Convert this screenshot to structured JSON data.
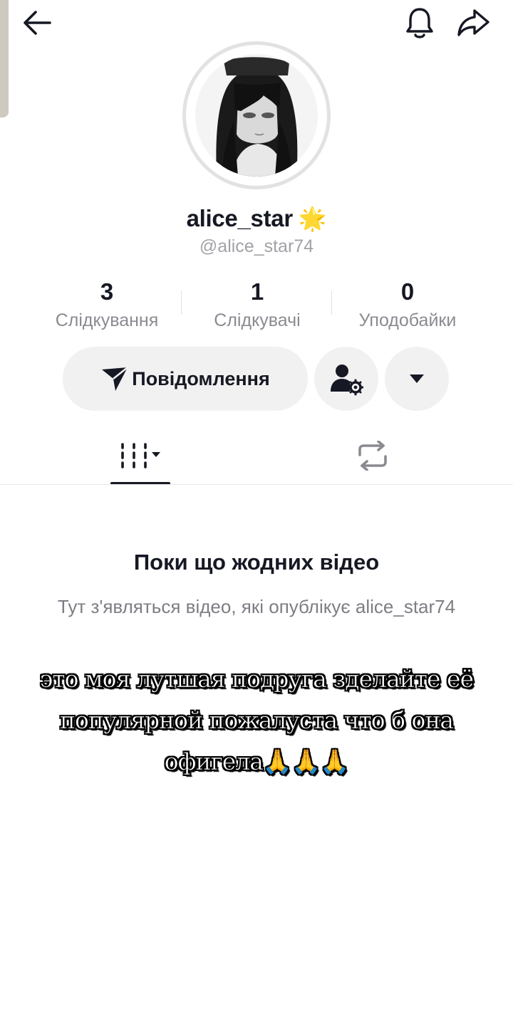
{
  "profile": {
    "display_name": "alice_star",
    "name_badge": "🌟",
    "username": "@alice_star74"
  },
  "stats": [
    {
      "value": "3",
      "label": "Слідкування"
    },
    {
      "value": "1",
      "label": "Слідкувачі"
    },
    {
      "value": "0",
      "label": "Уподобайки"
    }
  ],
  "actions": {
    "message_label": "Повідомлення"
  },
  "tabs": {
    "active": "videos"
  },
  "empty_state": {
    "title": "Поки що жодних відео",
    "subtitle": "Тут з'являться відео, які опублікує alice_star74"
  },
  "overlay_caption": "это моя лутшая подруга зделайте её популярной пожалуста что б она офигела🙏🙏🙏",
  "colors": {
    "text": "#161823",
    "muted": "#8a8b91",
    "button_bg": "#f1f1f2"
  }
}
